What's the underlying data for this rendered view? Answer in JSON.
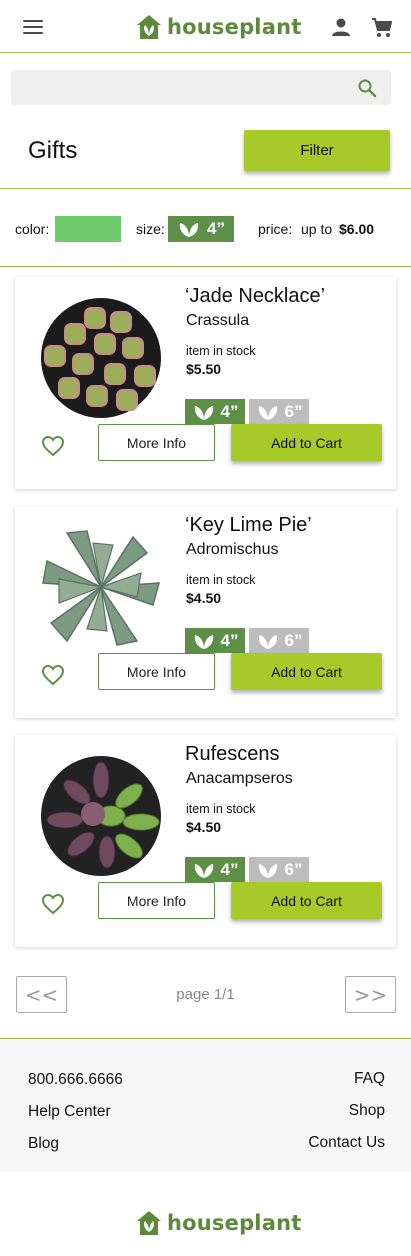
{
  "header": {
    "brand": "houseplant",
    "icons": {
      "menu": "menu-icon",
      "user": "user-icon",
      "cart": "cart-icon"
    },
    "colors": {
      "brand_green": "#5d8a3a",
      "divider": "#9bbd4a"
    }
  },
  "search": {
    "placeholder": "",
    "value": "",
    "icon": "search-icon"
  },
  "page": {
    "title": "Gifts",
    "filter_label": "Filter"
  },
  "filters": {
    "color_label": "color:",
    "color_value": "#6cca6a",
    "size_label": "size:",
    "size_value": "4”",
    "price_label": "price:",
    "price_prefix": "up to",
    "price_value": "$6.00"
  },
  "products": [
    {
      "name": "‘Jade Necklace’",
      "genus": "Crassula",
      "stock": "item in stock",
      "price": "$5.50",
      "sizes": [
        "4”",
        "6”"
      ],
      "selected_size": "4”",
      "more_info": "More Info",
      "add_to_cart": "Add to Cart"
    },
    {
      "name": "‘Key Lime Pie’",
      "genus": "Adromischus",
      "stock": "item in stock",
      "price": "$4.50",
      "sizes": [
        "4”",
        "6”"
      ],
      "selected_size": "4”",
      "more_info": "More Info",
      "add_to_cart": "Add to Cart"
    },
    {
      "name": "Rufescens",
      "genus": "Anacampseros",
      "stock": "item in stock",
      "price": "$4.50",
      "sizes": [
        "4”",
        "6”"
      ],
      "selected_size": "4”",
      "more_info": "More Info",
      "add_to_cart": "Add to Cart"
    }
  ],
  "pagination": {
    "prev": "<<",
    "label": "page 1/1",
    "next": ">>"
  },
  "footer": {
    "left": [
      "800.666.6666",
      "Help Center",
      "Blog"
    ],
    "right": [
      "FAQ",
      "Shop",
      "Contact Us"
    ],
    "brand": "houseplant"
  },
  "theme": {
    "accent": "#a8c92a",
    "size_active": "#5e8f48",
    "size_inactive": "#bdbdbd"
  }
}
